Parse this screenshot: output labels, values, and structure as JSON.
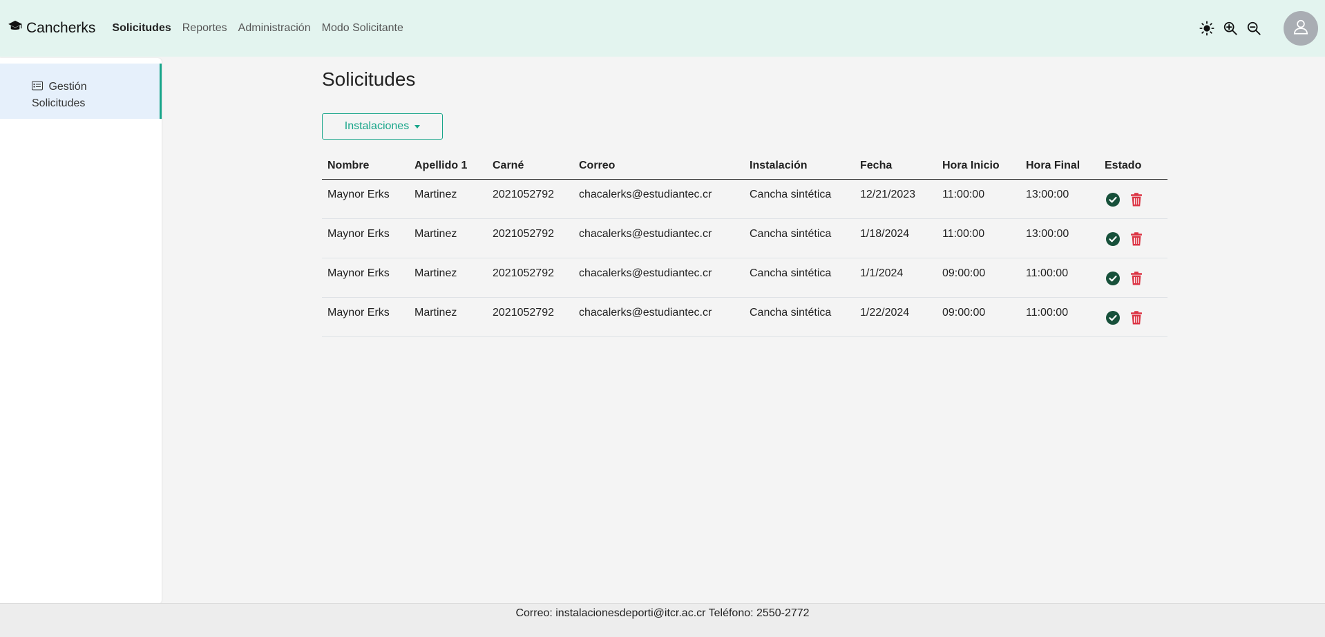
{
  "nav": {
    "brand": "Cancherks",
    "links": [
      "Solicitudes",
      "Reportes",
      "Administración",
      "Modo Solicitante"
    ]
  },
  "sidebar": {
    "items": [
      {
        "label_line1": "Gestión",
        "label_line2": "Solicitudes",
        "icon": "card-list-icon"
      }
    ]
  },
  "main": {
    "title": "Solicitudes",
    "dropdown_label": "Instalaciones",
    "table": {
      "headers": [
        "Nombre",
        "Apellido 1",
        "Carné",
        "Correo",
        "Instalación",
        "Fecha",
        "Hora Inicio",
        "Hora Final",
        "Estado"
      ],
      "rows": [
        [
          "Maynor Erks",
          "Martinez",
          "2021052792",
          "chacalerks@estudiantec.cr",
          "Cancha sintética",
          "12/21/2023",
          "11:00:00",
          "13:00:00"
        ],
        [
          "Maynor Erks",
          "Martinez",
          "2021052792",
          "chacalerks@estudiantec.cr",
          "Cancha sintética",
          "1/18/2024",
          "11:00:00",
          "13:00:00"
        ],
        [
          "Maynor Erks",
          "Martinez",
          "2021052792",
          "chacalerks@estudiantec.cr",
          "Cancha sintética",
          "1/1/2024",
          "09:00:00",
          "11:00:00"
        ],
        [
          "Maynor Erks",
          "Martinez",
          "2021052792",
          "chacalerks@estudiantec.cr",
          "Cancha sintética",
          "1/22/2024",
          "09:00:00",
          "11:00:00"
        ]
      ]
    }
  },
  "footer": {
    "text": "Correo: instalacionesdeporti@itcr.ac.cr Teléfono: 2550-2772"
  },
  "colors": {
    "navbar_bg": "#e3f4ef",
    "accent": "#17a589",
    "approve": "#17503a",
    "delete": "#dc3545"
  },
  "icons": [
    "graduation-cap-icon",
    "sun-icon",
    "zoom-in-icon",
    "zoom-out-icon",
    "user-icon",
    "card-list-icon",
    "check-circle-icon",
    "trash-icon"
  ]
}
